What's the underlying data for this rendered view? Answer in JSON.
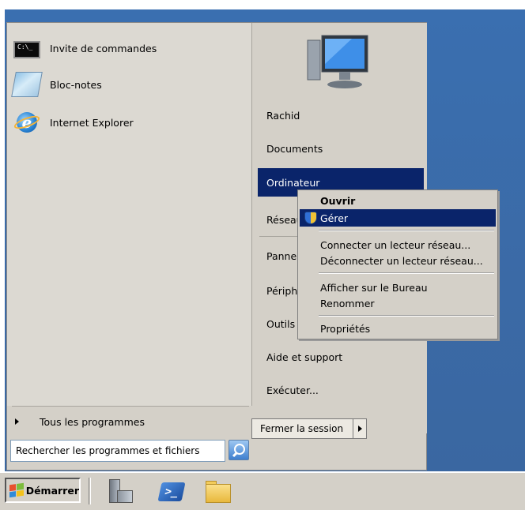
{
  "start_menu": {
    "pinned": [
      {
        "label": "Invite de commandes",
        "icon": "cmd-icon",
        "icon_text": "C:\\_"
      },
      {
        "label": "Bloc-notes",
        "icon": "notepad-icon"
      },
      {
        "label": "Internet Explorer",
        "icon": "internet-explorer-icon",
        "icon_text": "e"
      }
    ],
    "all_programs": "Tous les programmes",
    "search_placeholder": "Rechercher les programmes et fichiers",
    "right_items": [
      "Rachid",
      "Documents",
      "Ordinateur",
      "Réseau",
      "Panneau de configuration",
      "Périphériques et imprimantes",
      "Outils d'administration",
      "Aide et support",
      "Exécuter..."
    ],
    "logoff_label": "Fermer la session"
  },
  "context_menu": {
    "items": {
      "open": "Ouvrir",
      "manage": "Gérer",
      "map_drive": "Connecter un lecteur réseau...",
      "disconnect_drive": "Déconnecter un lecteur réseau...",
      "show_desktop": "Afficher sur le Bureau",
      "rename": "Renommer",
      "properties": "Propriétés"
    }
  },
  "taskbar": {
    "start_label": "Démarrer",
    "powershell_glyph": ">_"
  },
  "colors": {
    "selection": "#0a246a",
    "menu_bg": "#d4d0c8",
    "desktop": "#3a6fb0"
  }
}
